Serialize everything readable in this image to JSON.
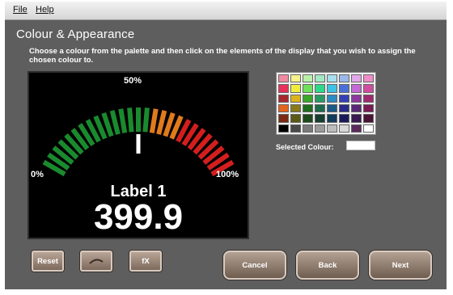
{
  "menu": {
    "file": "File",
    "help": "Help"
  },
  "page": {
    "title": "Colour & Appearance",
    "instruction": "Choose a colour from the palette and then click on the elements of the display that you wish to assign the chosen colour to."
  },
  "display": {
    "label_min": "0%",
    "label_mid": "50%",
    "label_max": "100%",
    "label_name": "Label 1",
    "value": "399.9",
    "gauge_level_fraction": 0.5,
    "segment_colors": [
      "#1a8a2e",
      "#1a8a2e",
      "#1a8a2e",
      "#1a8a2e",
      "#1a8a2e",
      "#1a8a2e",
      "#1a8a2e",
      "#1a8a2e",
      "#1a8a2e",
      "#1a8a2e",
      "#1a8a2e",
      "#1a8a2e",
      "#1a8a2e",
      "#1a8a2e",
      "#1a8a2e",
      "#e07a1c",
      "#e07a1c",
      "#e07a1c",
      "#e07a1c",
      "#d41e1e",
      "#d41e1e",
      "#d41e1e",
      "#d41e1e",
      "#d41e1e",
      "#d41e1e",
      "#d41e1e",
      "#d41e1e"
    ]
  },
  "palette": {
    "colors": [
      [
        "#ee8aa0",
        "#f5f28a",
        "#b9f0a8",
        "#a2e8c2",
        "#a5e0ef",
        "#9ab8ea",
        "#e2a6ea",
        "#f08cc8"
      ],
      [
        "#e8305a",
        "#f0ec3e",
        "#6fe05a",
        "#2ed888",
        "#3ec2e4",
        "#4a70d8",
        "#c46ad6",
        "#d04da0"
      ],
      [
        "#a82830",
        "#dcb41a",
        "#3aa82a",
        "#2a9a64",
        "#2a8cc2",
        "#3440b4",
        "#8c3a9c",
        "#a02a70"
      ],
      [
        "#e4641a",
        "#8a7a18",
        "#1c6e1e",
        "#1d6a4a",
        "#1a5a86",
        "#2a2a8a",
        "#5a2878",
        "#7a1a52"
      ],
      [
        "#7a2a14",
        "#5a5a14",
        "#1c4a1a",
        "#153e2e",
        "#123a5a",
        "#1a1a5a",
        "#3a1850",
        "#4a1234"
      ],
      [
        "#000000",
        "#4a4a4a",
        "#7a7a7a",
        "#9a9a9a",
        "#bcbcbc",
        "#d8d8d8",
        "#5a2a5a",
        "#ffffff"
      ]
    ],
    "selected_label": "Selected Colour:",
    "selected_color": "#ffffff"
  },
  "buttons": {
    "reset": "Reset",
    "undo_icon": "undo-curve-icon",
    "fx": "fX",
    "cancel": "Cancel",
    "back": "Back",
    "next": "Next"
  },
  "colors": {
    "window_bg": "#5e5e5e",
    "button_face": "#8f7b6c"
  }
}
